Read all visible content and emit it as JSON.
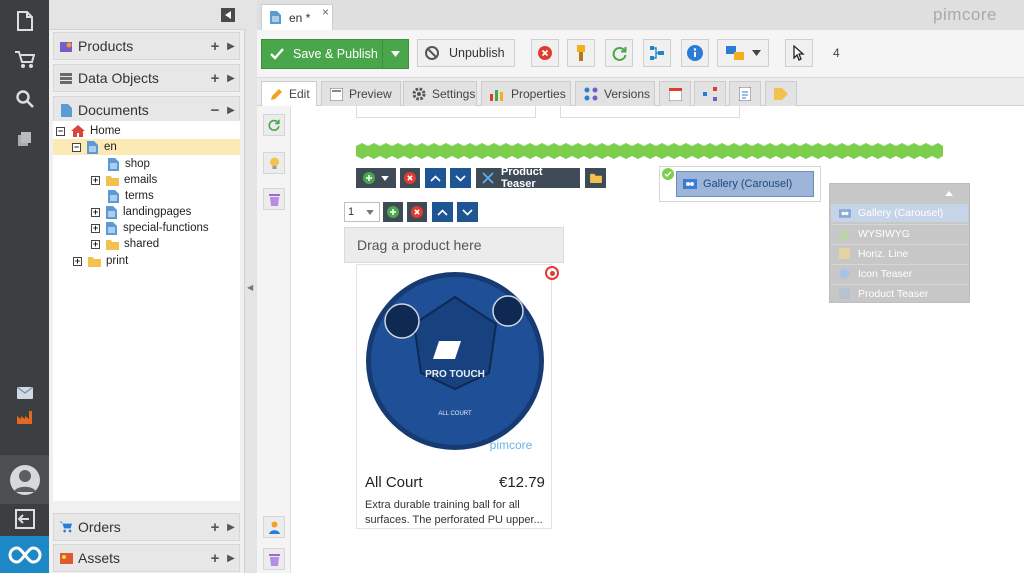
{
  "app": {
    "brand": "pimcore"
  },
  "tree_panel": {
    "sections_top": [
      {
        "label": "Products",
        "sign": "+",
        "icon": "products-icon"
      },
      {
        "label": "Data Objects",
        "sign": "+",
        "icon": "data-objects-icon"
      },
      {
        "label": "Documents",
        "sign": "−",
        "icon": "documents-icon"
      }
    ],
    "sections_bottom": [
      {
        "label": "Orders",
        "sign": "+",
        "icon": "cart-icon"
      },
      {
        "label": "Assets",
        "sign": "+",
        "icon": "assets-icon"
      }
    ],
    "tree": {
      "home": "Home",
      "en": "en",
      "shop": "shop",
      "emails": "emails",
      "terms": "terms",
      "landingpages": "landingpages",
      "special_functions": "special-functions",
      "shared": "shared",
      "print": "print"
    },
    "expander": {
      "minus": "−",
      "plus": "+"
    }
  },
  "document_tab": {
    "label": "en *",
    "close": "×"
  },
  "toolbar": {
    "save_publish": "Save & Publish",
    "unpublish": "Unpublish",
    "version_count": "4"
  },
  "subtabs": [
    "Edit",
    "Preview",
    "Settings",
    "Properties",
    "Versions"
  ],
  "editor": {
    "product_teaser_label": "Product Teaser",
    "page_select": "1",
    "drag_hint": "Drag a product here",
    "gallery_carousel_chip": "Gallery (Carousel)",
    "product": {
      "name": "All Court",
      "price": "€12.79",
      "description": "Extra durable training ball for all surfaces. The perforated PU upper...",
      "ball_text": "PRO TOUCH",
      "ball_subtext": "ALL COURT",
      "watermark": "pimcore"
    }
  },
  "area_menu": {
    "items": [
      "Gallery (Carousel)",
      "WYSIWYG",
      "Horiz. Line",
      "Icon Teaser",
      "Product Teaser"
    ]
  },
  "colors": {
    "save_green": "#4aa64a",
    "dark_bar": "#3c3f41",
    "accent_blue": "#1e88c7",
    "area_menu_bg": "#c7c7c7",
    "highlight_green": "#7ccf4c"
  }
}
